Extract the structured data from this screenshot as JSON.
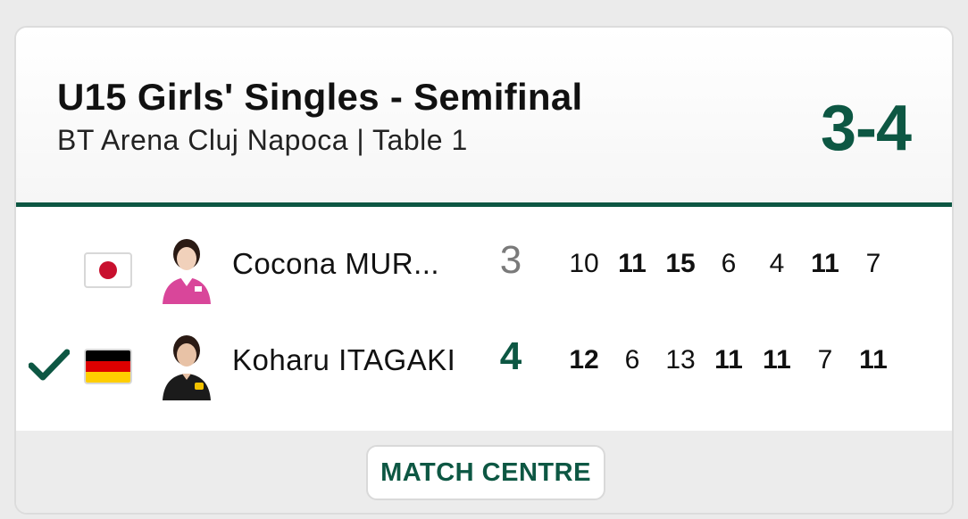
{
  "match": {
    "title": "U15 Girls' Singles - Semifinal",
    "venue": "BT Arena Cluj Napoca | Table 1",
    "overall_score": "3-4"
  },
  "players": [
    {
      "name": "Cocona MUR...",
      "country_flag": "japan-flag",
      "games_won": "3",
      "winner": false,
      "game_scores": [
        "10",
        "11",
        "15",
        "6",
        "4",
        "11",
        "7"
      ]
    },
    {
      "name": "Koharu ITAGAKI",
      "country_flag": "germany-flag",
      "games_won": "4",
      "winner": true,
      "game_scores": [
        "12",
        "6",
        "13",
        "11",
        "11",
        "7",
        "11"
      ]
    }
  ],
  "footer": {
    "match_centre_label": "MATCH CENTRE"
  },
  "colors": {
    "accent": "#0d5743",
    "loser_games": "#7a7a7a"
  }
}
